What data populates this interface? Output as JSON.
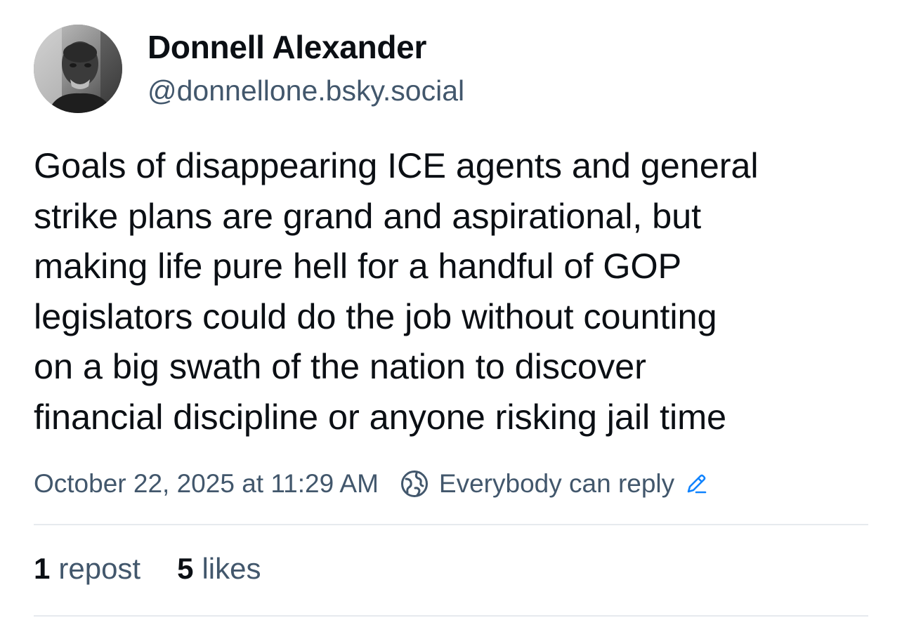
{
  "author": {
    "display_name": "Donnell Alexander",
    "handle": "@donnellone.bsky.social"
  },
  "post": {
    "text": "Goals of disappearing ICE agents and general\nstrike plans are grand and aspirational, but\nmaking life pure hell for a handful of GOP\nlegislators could do the job without counting\non a big swath of the nation to discover\nfinancial discipline or  anyone risking jail time",
    "timestamp": "October 22, 2025 at 11:29 AM",
    "reply_setting": "Everybody can reply"
  },
  "stats": {
    "reposts_count": "1",
    "reposts_label": "repost",
    "likes_count": "5",
    "likes_label": "likes"
  },
  "icons": {
    "reply_setting_icon": "globe-icon",
    "edit_icon": "pencil-icon"
  },
  "colors": {
    "text_primary": "#0b0f14",
    "text_secondary": "#42576c",
    "divider": "#e6eaee",
    "accent": "#1083fe"
  }
}
